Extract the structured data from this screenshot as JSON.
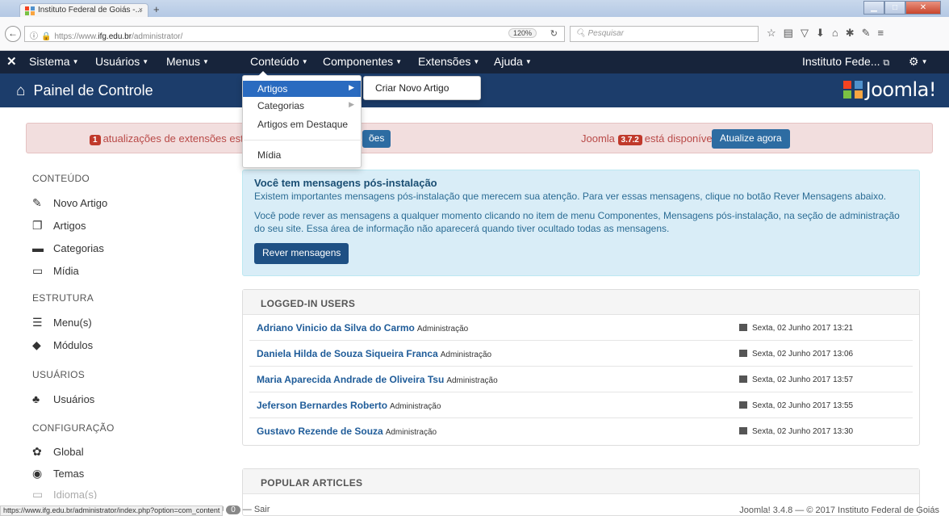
{
  "browser": {
    "tab_title": "Instituto Federal de Goiás -...",
    "tab_close": "×",
    "new_tab": "+",
    "url_prefix": "https://www.",
    "url_host": "ifg.edu.br",
    "url_path": "/administrator/",
    "zoom": "120%",
    "search_placeholder": "Pesquisar",
    "status_url": "https://www.ifg.edu.br/administrator/index.php?option=com_content"
  },
  "topnav": {
    "items": [
      "Sistema",
      "Usuários",
      "Menus",
      "Conteúdo",
      "Componentes",
      "Extensões",
      "Ajuda"
    ],
    "site_name": "Instituto Fede..."
  },
  "header": {
    "title": "Painel de Controle",
    "brand": "Joomla!"
  },
  "dropdown": {
    "items": [
      "Artigos",
      "Categorias",
      "Artigos em Destaque",
      "Mídia"
    ],
    "submenu": "Criar Novo Artigo"
  },
  "alerts": {
    "ext_count": "1",
    "ext_text": "atualizações de extensões estão",
    "ext_button": "ões",
    "joomla_prefix": "Joomla",
    "joomla_version": "3.7.2",
    "joomla_suffix": "está disponível:",
    "update_button": "Atualize agora"
  },
  "sidebar": {
    "sections": [
      {
        "title": "CONTEÚDO",
        "items": [
          "Novo Artigo",
          "Artigos",
          "Categorias",
          "Mídia"
        ]
      },
      {
        "title": "ESTRUTURA",
        "items": [
          "Menu(s)",
          "Módulos"
        ]
      },
      {
        "title": "USUÁRIOS",
        "items": [
          "Usuários"
        ]
      },
      {
        "title": "CONFIGURAÇÃO",
        "items": [
          "Global",
          "Temas",
          "Idioma(s)"
        ]
      }
    ]
  },
  "postinstall": {
    "title": "Você tem mensagens pós-instalação",
    "p1": "Existem importantes mensagens pós-instalação que merecem sua atenção. Para ver essas mensagens, clique no botão Rever Mensagens abaixo.",
    "p2": "Você pode rever as mensagens a qualquer momento clicando no item de menu Componentes, Mensagens pós-instalação, na seção de administração do seu site. Essa área de informação não aparecerá quando tiver ocultado todas as mensagens.",
    "button": "Rever mensagens"
  },
  "logged_in": {
    "title": "LOGGED-IN USERS",
    "users": [
      {
        "name": "Adriano Vinicio da Silva do Carmo",
        "role": "Administração",
        "date": "Sexta, 02 Junho 2017 13:21"
      },
      {
        "name": "Daniela Hilda de Souza Siqueira Franca",
        "role": "Administração",
        "date": "Sexta, 02 Junho 2017 13:06"
      },
      {
        "name": "Maria Aparecida Andrade de Oliveira Tsu",
        "role": "Administração",
        "date": "Sexta, 02 Junho 2017 13:57"
      },
      {
        "name": "Jeferson Bernardes Roberto",
        "role": "Administração",
        "date": "Sexta, 02 Junho 2017 13:55"
      },
      {
        "name": "Gustavo Rezende de Souza",
        "role": "Administração",
        "date": "Sexta, 02 Junho 2017 13:30"
      }
    ]
  },
  "popular": {
    "title": "POPULAR ARTICLES"
  },
  "footer": {
    "messages_count": "0",
    "logout": "Sair",
    "copyright": "Joomla! 3.4.8 — © 2017 Instituto Federal de Goiás"
  }
}
